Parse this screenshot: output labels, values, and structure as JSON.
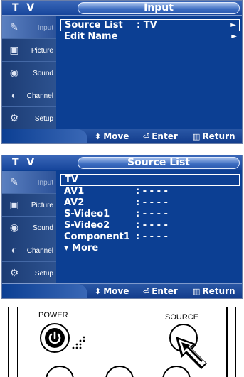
{
  "screen1": {
    "app_label": "T V",
    "menu_title": "Input",
    "sidebar": [
      {
        "label": "Input",
        "icon": "input-plug-icon",
        "active": true
      },
      {
        "label": "Picture",
        "icon": "picture-icon",
        "active": false
      },
      {
        "label": "Sound",
        "icon": "sound-icon",
        "active": false
      },
      {
        "label": "Channel",
        "icon": "channel-icon",
        "active": false
      },
      {
        "label": "Setup",
        "icon": "setup-icon",
        "active": false
      }
    ],
    "items": [
      {
        "label": "Source List",
        "value": ": TV",
        "arrow": "►",
        "selected": true
      },
      {
        "label": "Edit Name",
        "value": "",
        "arrow": "►",
        "selected": false
      }
    ],
    "hints": {
      "move": "Move",
      "enter": "Enter",
      "return": "Return"
    }
  },
  "screen2": {
    "app_label": "T V",
    "menu_title": "Source List",
    "sidebar": [
      {
        "label": "Input",
        "icon": "input-plug-icon",
        "active": true
      },
      {
        "label": "Picture",
        "icon": "picture-icon",
        "active": false
      },
      {
        "label": "Sound",
        "icon": "sound-icon",
        "active": false
      },
      {
        "label": "Channel",
        "icon": "channel-icon",
        "active": false
      },
      {
        "label": "Setup",
        "icon": "setup-icon",
        "active": false
      }
    ],
    "items": [
      {
        "label": "TV",
        "value": "",
        "selected": true
      },
      {
        "label": "AV1",
        "value": ": - - - -",
        "selected": false
      },
      {
        "label": "AV2",
        "value": ": - - - -",
        "selected": false
      },
      {
        "label": "S-Video1",
        "value": ": - - - -",
        "selected": false
      },
      {
        "label": "S-Video2",
        "value": ": - - - -",
        "selected": false
      },
      {
        "label": "Component1",
        "value": ": - - - -",
        "selected": false
      },
      {
        "label": "▾ More",
        "value": "",
        "selected": false
      }
    ],
    "hints": {
      "move": "Move",
      "enter": "Enter",
      "return": "Return"
    }
  },
  "remote": {
    "power_label": "POWER",
    "source_label": "SOURCE"
  },
  "colors": {
    "osd_background": "#0c3f93",
    "title_pill": "#3b6bc0",
    "text": "#ffffff"
  }
}
